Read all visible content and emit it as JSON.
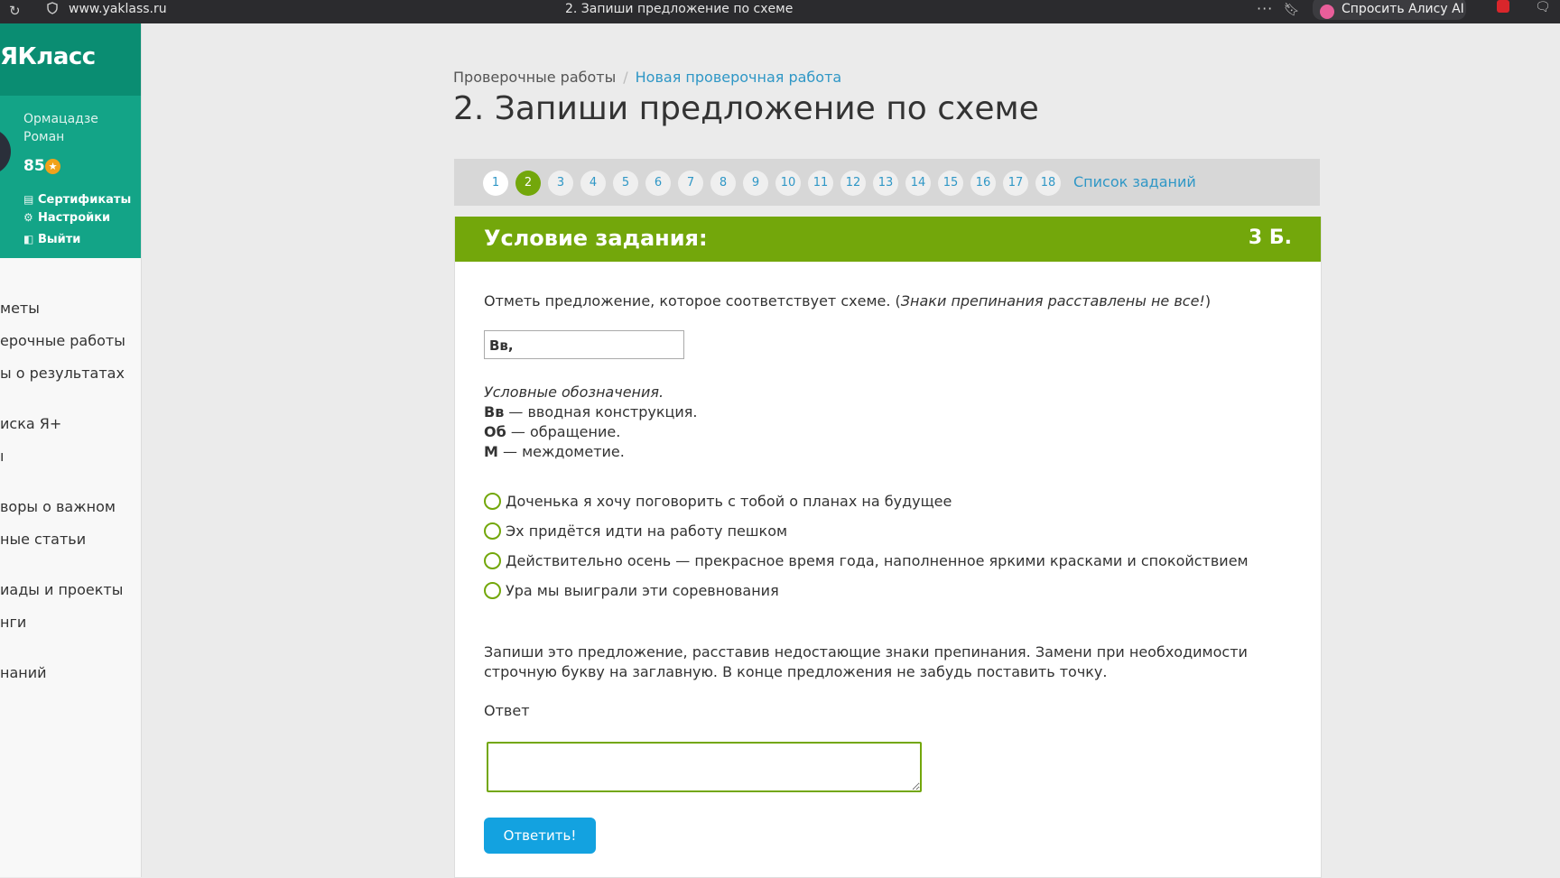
{
  "browser": {
    "url": "www.yaklass.ru",
    "tab_title": "2. Запиши предложение по схеме",
    "dots": "···",
    "assistant_label": "Спросить Алису AI"
  },
  "sidebar": {
    "logo": "ЯКласс",
    "user_name": "Ормацадзе Роман",
    "points": "85",
    "profile_links": [
      {
        "label": "Сертификаты",
        "icon": "certificate-icon"
      },
      {
        "label": "Настройки",
        "icon": "gear-icon"
      },
      {
        "label": "Выйти",
        "icon": "exit-icon"
      }
    ],
    "nav": [
      "меты",
      "ерочные работы",
      "ы о результатах",
      "иска Я+",
      "ı",
      "воры о важном",
      "ные статьи",
      "иады и проекты",
      "нги",
      "наний"
    ]
  },
  "breadcrumb": {
    "parent": "Проверочные работы",
    "separator": "/",
    "current": "Новая проверочная работа"
  },
  "page_title": "2. Запиши предложение по схеме",
  "pager": {
    "numbers": [
      "1",
      "2",
      "3",
      "4",
      "5",
      "6",
      "7",
      "8",
      "9",
      "10",
      "11",
      "12",
      "13",
      "14",
      "15",
      "16",
      "17",
      "18"
    ],
    "active": "2",
    "list_link": "Список заданий"
  },
  "task": {
    "header": "Условие задания:",
    "points": "3 Б.",
    "instruction_main": "Отметь предложение, которое соответствует схеме. (",
    "instruction_italic": "Знаки препинания расставлены не все!",
    "instruction_close": ")",
    "scheme": "Вв,",
    "legend_title": "Условные обозначения.",
    "legend": [
      {
        "abbr": "Вв",
        "text": " — вводная конструкция."
      },
      {
        "abbr": "Об",
        "text": " — обращение."
      },
      {
        "abbr": "М",
        "text": " — междометие."
      }
    ],
    "options": [
      "Доченька я хочу поговорить с тобой о планах на будущее",
      "Эх придётся идти на работу пешком",
      "Действительно осень — прекрасное время года, наполненное яркими красками и спокойствием",
      "Ура мы выиграли эти соревнования"
    ],
    "write_instruction": "Запиши это предложение, расставив недостающие знаки препинания. Замени при необходимости строчную букву на заглавную. В конце предложения не забудь поставить точку.",
    "answer_label": "Ответ",
    "answer_value": "",
    "submit": "Ответить!"
  },
  "colors": {
    "green": "#73a70b",
    "teal": "#13a487",
    "link": "#2f97c6",
    "button": "#13a2e0"
  }
}
